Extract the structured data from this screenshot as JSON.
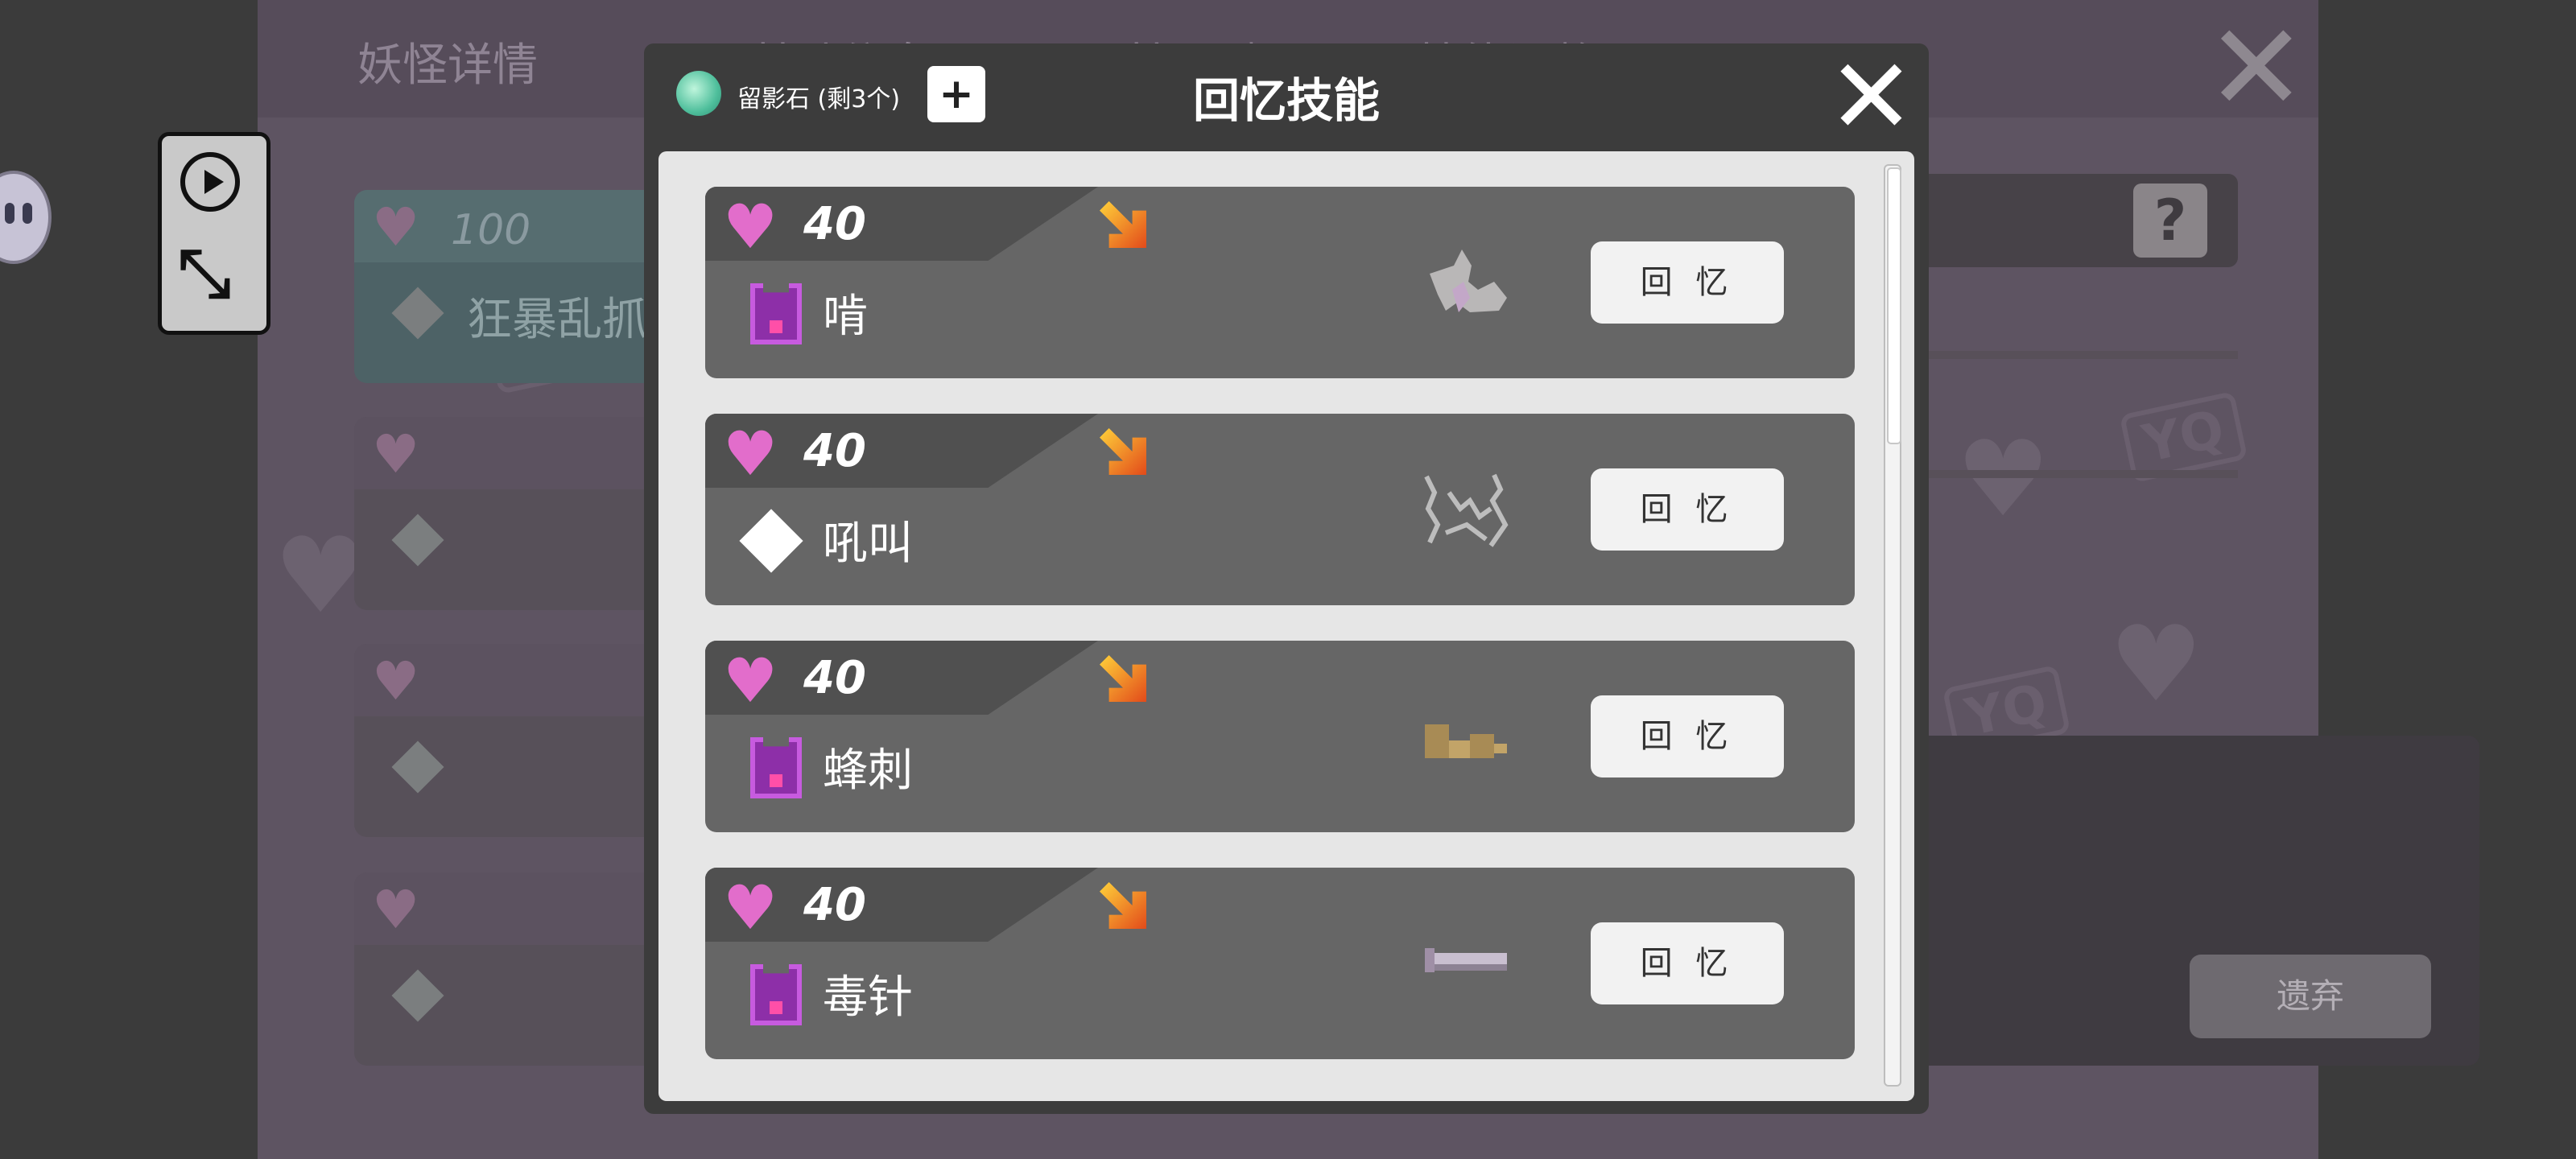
{
  "background": {
    "tabs": [
      "妖怪详情",
      "基础信息",
      "属性天赋",
      "技能调整"
    ],
    "first_card_hp": "100",
    "first_card_skill": "狂暴乱抓",
    "watermark": "YQ",
    "discard_label": "遗弃",
    "question_mark": "?",
    "close_glyph": "✕"
  },
  "modal": {
    "title": "回忆技能",
    "stone_label": "留影石 (剩3个)",
    "add_label": "+",
    "close_glyph": "✕",
    "skills": [
      {
        "cost": "40",
        "name": "啃",
        "type": "bug",
        "sprite": "claw-sprite",
        "button": "回 忆"
      },
      {
        "cost": "40",
        "name": "吼叫",
        "type": "normal",
        "sprite": "roar-sprite",
        "button": "回 忆"
      },
      {
        "cost": "40",
        "name": "蜂刺",
        "type": "bug",
        "sprite": "sting-sprite",
        "button": "回 忆"
      },
      {
        "cost": "40",
        "name": "毒针",
        "type": "bug",
        "sprite": "needle-sprite",
        "button": "回 忆"
      }
    ]
  },
  "colors": {
    "heart": "#e26dcb",
    "accent_arrow": "#e24a1a",
    "stone": "#4fbf9c"
  }
}
